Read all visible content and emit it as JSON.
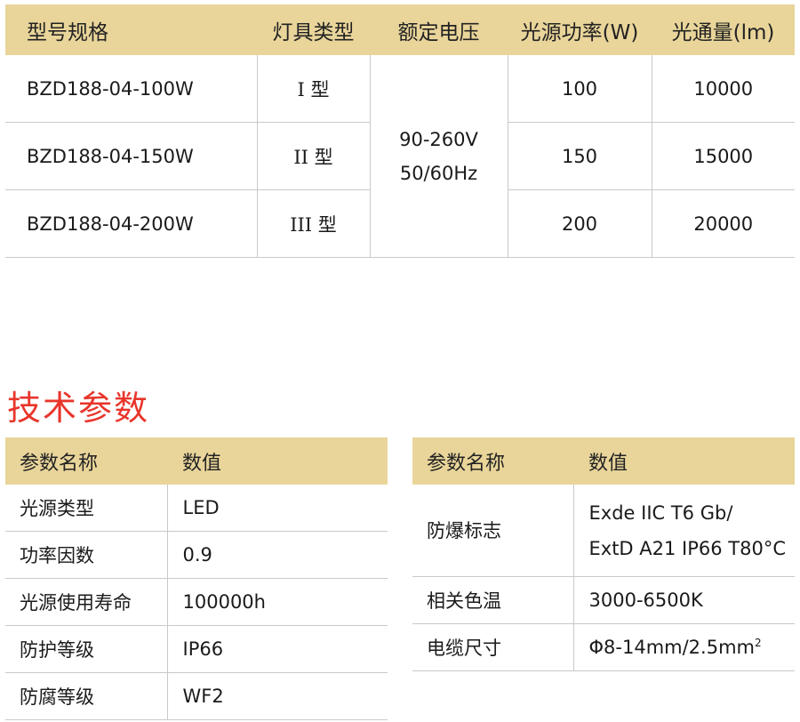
{
  "model_table": {
    "headers": [
      "型号规格",
      "灯具类型",
      "额定电压",
      "光源功率(W)",
      "光通量(lm)"
    ],
    "rows": [
      {
        "model": "BZD188-04-100W",
        "type_roman": "I",
        "type_suffix": "型",
        "power": "100",
        "flux": "10000"
      },
      {
        "model": "BZD188-04-150W",
        "type_roman": "II",
        "type_suffix": "型",
        "power": "150",
        "flux": "15000"
      },
      {
        "model": "BZD188-04-200W",
        "type_roman": "III",
        "type_suffix": "型",
        "power": "200",
        "flux": "20000"
      }
    ],
    "voltage_line1": "90-260V",
    "voltage_line2": "50/60Hz"
  },
  "section_title": "技术参数",
  "params_left": {
    "headers": [
      "参数名称",
      "数值"
    ],
    "rows": [
      {
        "name": "光源类型",
        "value": "LED"
      },
      {
        "name": "功率因数",
        "value": "0.9"
      },
      {
        "name": "光源使用寿命",
        "value": "100000h"
      },
      {
        "name": "防护等级",
        "value": "IP66"
      },
      {
        "name": "防腐等级",
        "value": "WF2"
      }
    ]
  },
  "params_right": {
    "headers": [
      "参数名称",
      "数值"
    ],
    "rows": [
      {
        "name": "防爆标志",
        "value_line1": "Exde IIC T6 Gb/",
        "value_line2": "ExtD A21 IP66 T80°C"
      },
      {
        "name": "相关色温",
        "value": "3000-6500K"
      },
      {
        "name": "电缆尺寸",
        "value": "Φ8-14mm/2.5mm",
        "value_sup": "2"
      }
    ]
  },
  "colors": {
    "header_bg": "#e9d59a",
    "title_red": "#e8352b",
    "rule_gray": "#c9c9c9"
  }
}
